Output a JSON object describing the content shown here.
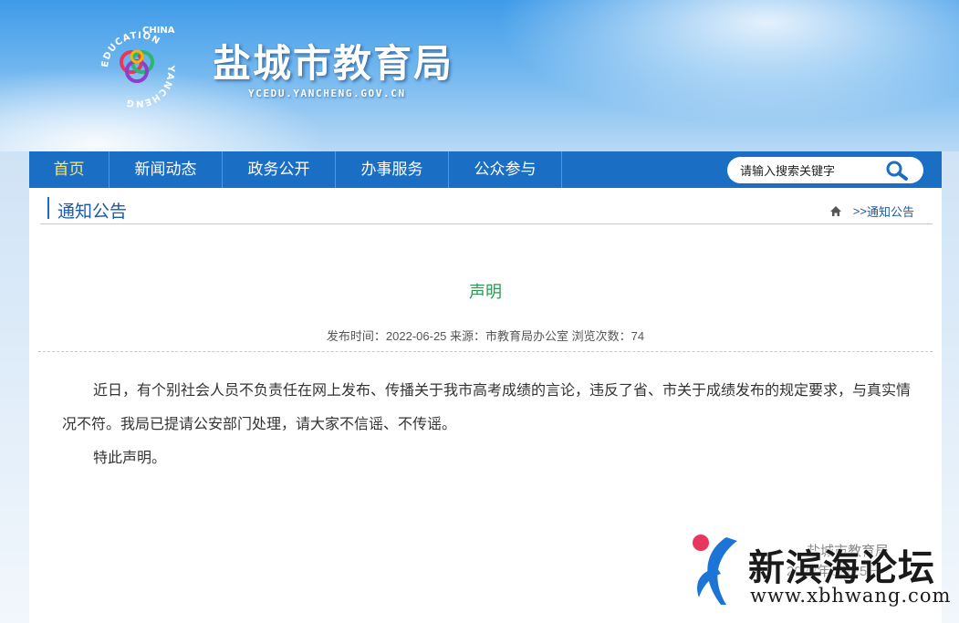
{
  "header": {
    "site_title": "盐城市教育局",
    "site_domain": "YCEDU.YANCHENG.GOV.CN",
    "logo_text_top": "CHINA",
    "logo_text_left": "EDUCATION",
    "logo_text_right": "YANCHENG"
  },
  "nav": {
    "items": [
      {
        "label": "首页",
        "active": true
      },
      {
        "label": "新闻动态",
        "active": false
      },
      {
        "label": "政务公开",
        "active": false
      },
      {
        "label": "办事服务",
        "active": false
      },
      {
        "label": "公众参与",
        "active": false
      }
    ]
  },
  "search": {
    "placeholder": "请输入搜索关键字"
  },
  "section": {
    "title": "通知公告",
    "breadcrumb_sep": ">>",
    "breadcrumb_current": "通知公告"
  },
  "article": {
    "title": "声明",
    "meta": "发布时间：2022-06-25 来源：市教育局办公室 浏览次数：74",
    "paragraphs": [
      "近日，有个别社会人员不负责任在网上发布、传播关于我市高考成绩的言论，违反了省、市关于成绩发布的规定要求，与真实情况不符。我局已提请公安部门处理，请大家不信谣、不传谣。",
      "特此声明。"
    ],
    "sign_org": "盐城市教育局",
    "sign_date": "2022年6月25日"
  },
  "watermark": {
    "name": "新滨海论坛",
    "url": "www.xbhwang.com"
  },
  "colors": {
    "nav_bg": "#1a6fc4",
    "nav_active": "#ffe36a",
    "title_green": "#2a9a55",
    "section_blue": "#1a5aa6"
  }
}
